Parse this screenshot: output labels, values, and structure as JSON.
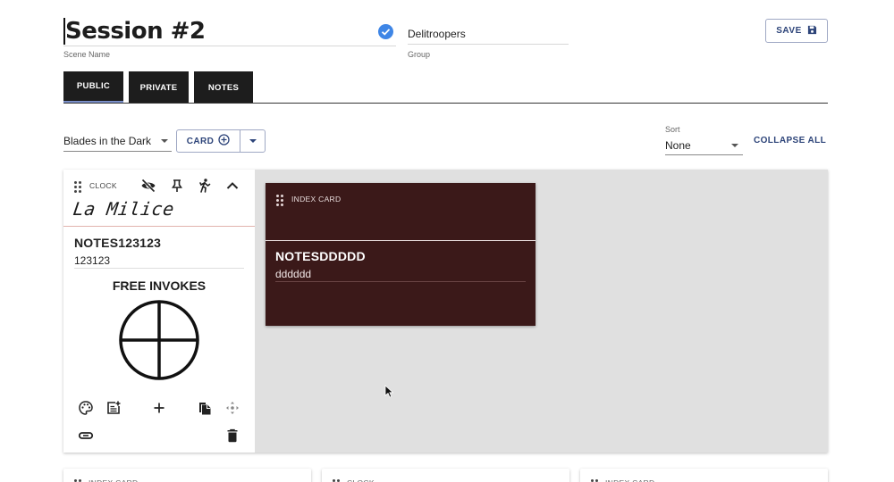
{
  "header": {
    "scene_name": "Session #2",
    "scene_name_label": "Scene Name",
    "group": "Delitroopers",
    "group_label": "Group",
    "save_label": "SAVE"
  },
  "tabs": [
    {
      "label": "PUBLIC",
      "active": true
    },
    {
      "label": "PRIVATE",
      "active": false
    },
    {
      "label": "NOTES",
      "active": false
    }
  ],
  "toolbar": {
    "system": "Blades in the Dark",
    "card_button": "CARD",
    "sort_label": "Sort",
    "sort_value": "None",
    "collapse_all": "COLLAPSE ALL"
  },
  "clock_card": {
    "type": "CLOCK",
    "title": "La Milice",
    "note_title": "NOTES123123",
    "note_text": "123123",
    "free_invokes": "FREE INVOKES",
    "clock_segments": 4,
    "clock_filled": 0
  },
  "index_card": {
    "type": "INDEX CARD",
    "note_title": "NOTESDDDDD",
    "note_text": "dddddd",
    "color": "#3b1919"
  },
  "bottom_cards": [
    {
      "type": "INDEX CARD"
    },
    {
      "type": "CLOCK"
    },
    {
      "type": "INDEX CARD"
    }
  ],
  "colors": {
    "accent": "#2d4479",
    "tab_bg": "#1d1d1d",
    "board_bg": "#e0e0e0",
    "check": "#3f86e6"
  }
}
